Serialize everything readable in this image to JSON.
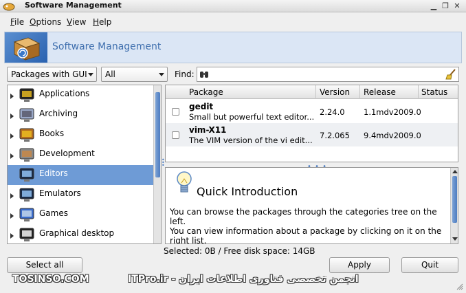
{
  "window": {
    "title": "Software Management",
    "close_glyph": "✕",
    "restore_glyph": "❐",
    "minimize_glyph": "▁"
  },
  "menu": {
    "items": [
      {
        "key": "F",
        "rest": "ile"
      },
      {
        "key": "O",
        "rest": "ptions"
      },
      {
        "key": "V",
        "rest": "iew"
      },
      {
        "key": "H",
        "rest": "elp"
      }
    ]
  },
  "banner": {
    "title": "Software Management",
    "icon": "software-package-icon"
  },
  "filters": {
    "view_selected": "Packages with GUI",
    "status_selected": "All",
    "find_label": "Find:",
    "find_value": ""
  },
  "categories": [
    {
      "label": "Applications",
      "icon": "applications-icon",
      "selected": false
    },
    {
      "label": "Archiving",
      "icon": "archiving-icon",
      "selected": false
    },
    {
      "label": "Books",
      "icon": "books-icon",
      "selected": false
    },
    {
      "label": "Development",
      "icon": "development-icon",
      "selected": false
    },
    {
      "label": "Editors",
      "icon": "editors-icon",
      "selected": true
    },
    {
      "label": "Emulators",
      "icon": "emulators-icon",
      "selected": false
    },
    {
      "label": "Games",
      "icon": "games-icon",
      "selected": false
    },
    {
      "label": "Graphical desktop",
      "icon": "graphical-desktop-icon",
      "selected": false
    }
  ],
  "table": {
    "columns": [
      "Package",
      "Version",
      "Release",
      "Status"
    ],
    "rows": [
      {
        "name": "gedit",
        "description": "Small but powerful text editor...",
        "version": "2.24.0",
        "release": "1.1mdv2009.0",
        "status": ""
      },
      {
        "name": "vim-X11",
        "description": "The VIM version of the vi edit...",
        "version": "7.2.065",
        "release": "9.4mdv2009.0",
        "status": ""
      }
    ]
  },
  "info": {
    "title": "Quick Introduction",
    "paragraphs": [
      "You can browse the packages through the categories tree on the left.",
      "You can view information about a package by clicking on it on the right list."
    ]
  },
  "status_text": "Selected: 0B / Free disk space: 14GB",
  "buttons": {
    "select_all": "Select all",
    "apply": "Apply",
    "quit": "Quit"
  },
  "watermark": {
    "left": "TOSINSO.COM",
    "right": "انجمن تخصصی فناوری اطلاعات ایران - ITPro.ir"
  },
  "colors": {
    "selection": "#6e9bd6",
    "banner_bg": "#dbe6f5",
    "banner_title": "#3f6fae"
  }
}
